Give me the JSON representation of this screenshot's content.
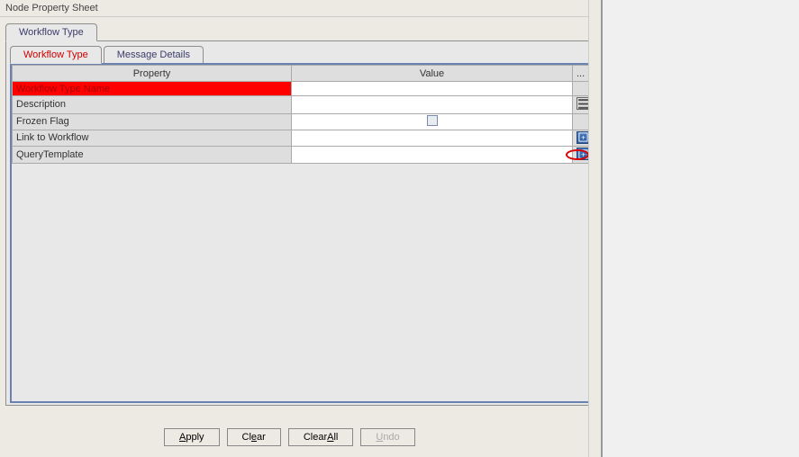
{
  "panel": {
    "title": "Node Property Sheet"
  },
  "outer_tab": {
    "label": "Workflow Type"
  },
  "inner_tabs": {
    "tab1": "Workflow Type",
    "tab2": "Message Details"
  },
  "table": {
    "headers": {
      "property": "Property",
      "value": "Value",
      "btn": "..."
    },
    "rows": [
      {
        "property": "Workflow Type Name",
        "value": "",
        "error": true,
        "action": "none"
      },
      {
        "property": "Description",
        "value": "",
        "action": "ellipsis"
      },
      {
        "property": "Frozen Flag",
        "value": "",
        "action": "checkbox"
      },
      {
        "property": "Link to Workflow",
        "value": "",
        "action": "picker"
      },
      {
        "property": "QueryTemplate",
        "value": "",
        "action": "picker",
        "highlight": true
      }
    ]
  },
  "footer": {
    "apply": "Apply",
    "clear": "Clear",
    "clearall": "ClearAll",
    "undo": "Undo"
  }
}
